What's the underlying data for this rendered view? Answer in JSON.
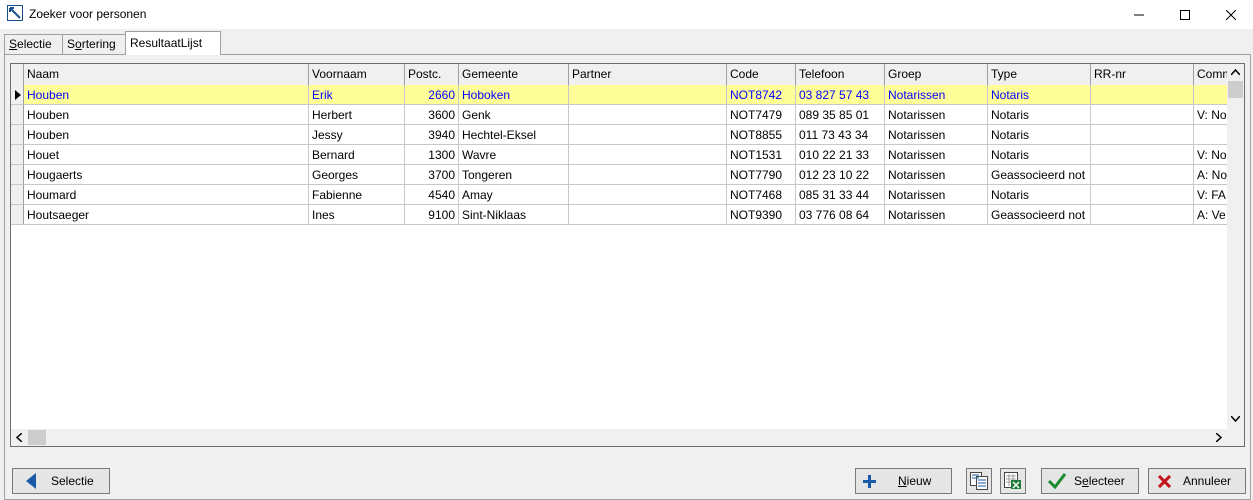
{
  "window": {
    "title": "Zoeker voor personen"
  },
  "tabs": [
    {
      "label_u": "S",
      "label_rest": "electie"
    },
    {
      "label_pre": "S",
      "label_u": "o",
      "label_rest": "rtering"
    },
    {
      "label": "ResultaatLijst"
    }
  ],
  "table": {
    "columns": [
      "Naam",
      "Voornaam",
      "Postc.",
      "Gemeente",
      "Partner",
      "Code",
      "Telefoon",
      "Groep",
      "Type",
      "RR-nr",
      "Comm"
    ],
    "rows": [
      [
        "Houben",
        "Erik",
        "2660",
        "Hoboken",
        "",
        "NOT8742",
        "03 827 57 43",
        "Notarissen",
        "Notaris",
        "",
        ""
      ],
      [
        "Houben",
        "Herbert",
        "3600",
        "Genk",
        "",
        "NOT7479",
        "089 35 85 01",
        "Notarissen",
        "Notaris",
        "",
        "V: No"
      ],
      [
        "Houben",
        "Jessy",
        "3940",
        "Hechtel-Eksel",
        "",
        "NOT8855",
        "011 73 43 34",
        "Notarissen",
        "Notaris",
        "",
        ""
      ],
      [
        "Houet",
        "Bernard",
        "1300",
        "Wavre",
        "",
        "NOT1531",
        "010 22 21 33",
        "Notarissen",
        "Notaris",
        "",
        "V: No"
      ],
      [
        "Hougaerts",
        "Georges",
        "3700",
        "Tongeren",
        "",
        "NOT7790",
        "012 23 10 22",
        "Notarissen",
        "Geassocieerd not",
        "",
        "A: No"
      ],
      [
        "Houmard",
        "Fabienne",
        "4540",
        "Amay",
        "",
        "NOT7468",
        "085 31 33 44",
        "Notarissen",
        "Notaris",
        "",
        "V: FA"
      ],
      [
        "Houtsaeger",
        "Ines",
        "9100",
        "Sint-Niklaas",
        "",
        "NOT9390",
        "03 776 08 64",
        "Notarissen",
        "Geassocieerd not",
        "",
        "A: Ve"
      ]
    ],
    "selected_row": 0
  },
  "buttons": {
    "selectie": "Selectie",
    "nieuw_u": "N",
    "nieuw_rest": "ieuw",
    "selecteer_pre": "S",
    "selecteer_u": "e",
    "selecteer_rest": "lecteer",
    "annuleer": "Annuleer"
  },
  "colors": {
    "selected_row_bg": "#ffff99",
    "selected_row_text": "#0000ff"
  }
}
